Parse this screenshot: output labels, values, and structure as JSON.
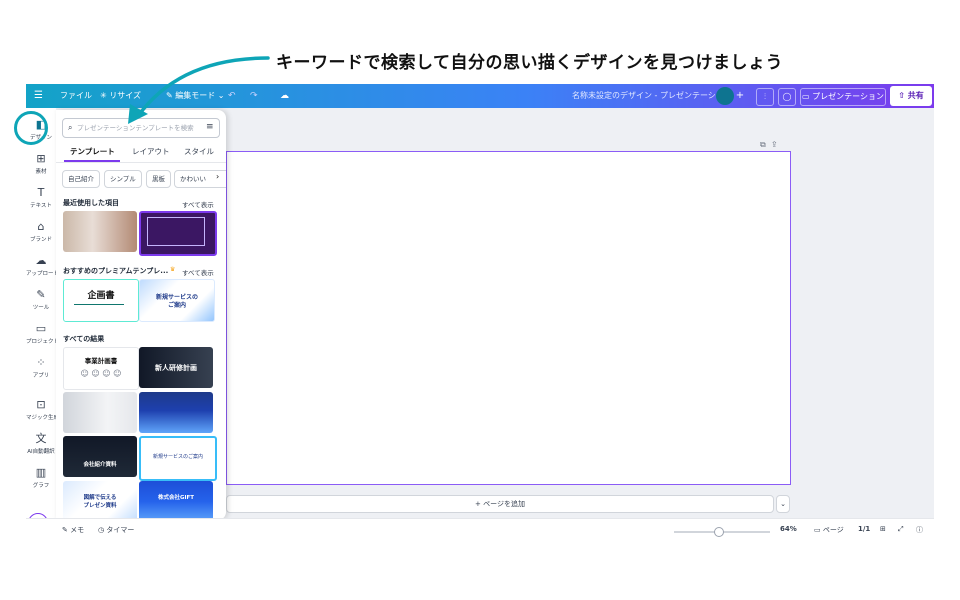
{
  "annotation": {
    "text": "キーワードで検索して自分の思い描くデザインを見つけましょう"
  },
  "topbar": {
    "menu_icon": "hamburger-icon",
    "file_label": "ファイル",
    "resize_label": "リサイズ",
    "edit_mode_label": "編集モード",
    "doc_title": "名称未設定のデザイン - プレゼンテーション",
    "present_label": "プレゼンテーション",
    "share_label": "共有",
    "plus": "+"
  },
  "rail": {
    "items": [
      {
        "label": "デザイン",
        "icon": "design-icon"
      },
      {
        "label": "素材",
        "icon": "elements-icon"
      },
      {
        "label": "テキスト",
        "icon": "text-icon"
      },
      {
        "label": "ブランド",
        "icon": "brand-icon"
      },
      {
        "label": "アップロード",
        "icon": "upload-icon"
      },
      {
        "label": "ツール",
        "icon": "draw-icon"
      },
      {
        "label": "プロジェクト",
        "icon": "folder-icon"
      },
      {
        "label": "アプリ",
        "icon": "apps-icon"
      },
      {
        "label": "マジック生成",
        "icon": "magic-media-icon"
      },
      {
        "label": "AI自動翻訳",
        "icon": "translate-icon"
      },
      {
        "label": "グラフ",
        "icon": "chart-icon"
      }
    ]
  },
  "panel": {
    "search_placeholder": "プレゼンテーションテンプレートを検索",
    "tabs": [
      "テンプレート",
      "レイアウト",
      "スタイル"
    ],
    "chips": [
      "自己紹介",
      "シンプル",
      "黒板",
      "かわいい"
    ],
    "recent_title": "最近使用した項目",
    "premium_title": "おすすめのプレミアムテンプレ...",
    "all_results_title": "すべての結果",
    "see_all": "すべて表示",
    "thumbs": {
      "t3": "企画書",
      "t4a": "新規サービスの",
      "t4b": "ご案内",
      "t5": "事業計画書",
      "t6": "新人研修計画",
      "t9": "会社紹介資料",
      "t10": "新規サービスのご案内",
      "t11a": "図解で伝える",
      "t11b": "プレゼン資料",
      "t12": "株式会社GIFT"
    }
  },
  "canvas": {
    "add_page_label": "+ ページを追加"
  },
  "bottombar": {
    "memo_label": "メモ",
    "timer_label": "タイマー",
    "zoom": "64%",
    "page_label": "ページ",
    "page_count": "1/1"
  }
}
